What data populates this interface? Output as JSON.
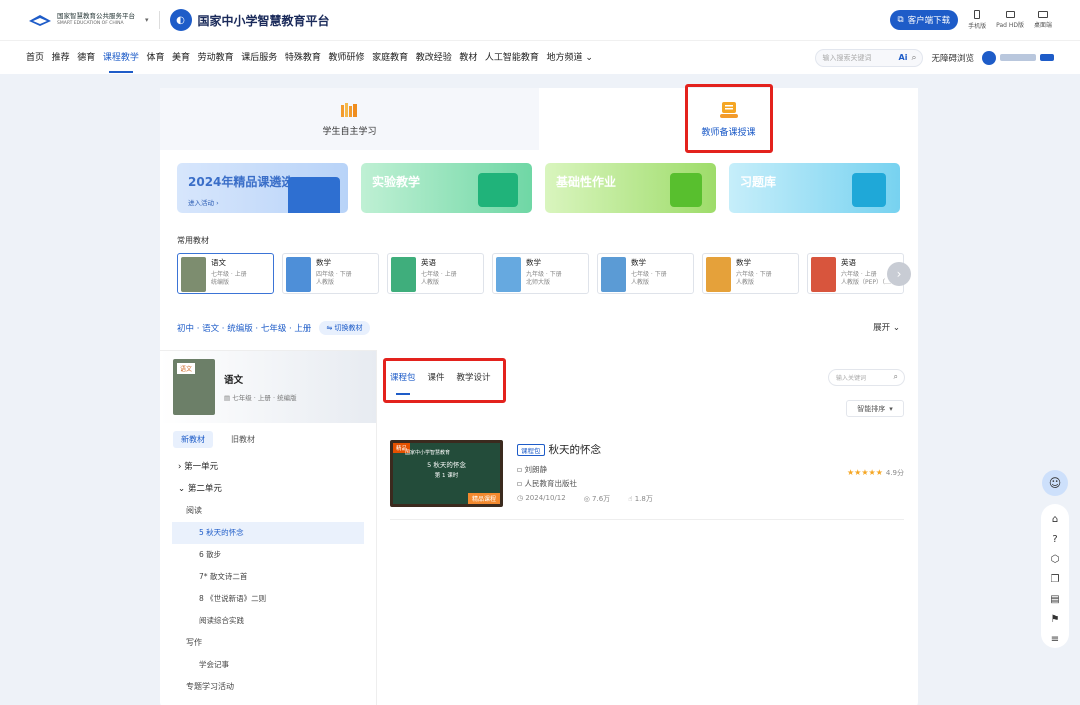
{
  "header": {
    "platform_cn": "国家智慧教育公共服务平台",
    "platform_en": "SMART EDUCATION OF CHINA",
    "site_name": "国家中小学智慧教育平台",
    "download_label": "客户端下载",
    "devices": [
      "手机版",
      "Pad HD版",
      "桌面端"
    ]
  },
  "nav": {
    "items": [
      "首页",
      "推荐",
      "德育",
      "课程教学",
      "体育",
      "美育",
      "劳动教育",
      "课后服务",
      "特殊教育",
      "教师研修",
      "家庭教育",
      "教改经验",
      "教材",
      "人工智能教育",
      "地方频道 ⌄"
    ],
    "active_index": 3,
    "search_placeholder": "输入搜索关键词",
    "ai_label": "Ai",
    "accessibility": "无障碍浏览"
  },
  "modes": [
    "学生自主学习",
    "教师备课授课"
  ],
  "banners": [
    {
      "title": "2024年精品课遴选",
      "sub": "进入活动 ›"
    },
    {
      "title": "实验教学",
      "sub": ""
    },
    {
      "title": "基础性作业",
      "sub": ""
    },
    {
      "title": "习题库",
      "sub": ""
    }
  ],
  "common_label": "常用教材",
  "books": [
    {
      "name": "语文",
      "grade": "七年级 · 上册",
      "ed": "统编版",
      "color": "#7d8d6f"
    },
    {
      "name": "数学",
      "grade": "四年级 · 下册",
      "ed": "人教版",
      "color": "#4e8fd8"
    },
    {
      "name": "英语",
      "grade": "七年级 · 上册",
      "ed": "人教版",
      "color": "#3fae7c"
    },
    {
      "name": "数学",
      "grade": "九年级 · 下册",
      "ed": "北师大版",
      "color": "#66a9e0"
    },
    {
      "name": "数学",
      "grade": "七年级 · 下册",
      "ed": "人教版",
      "color": "#5b9bd5"
    },
    {
      "name": "数学",
      "grade": "六年级 · 下册",
      "ed": "人教版",
      "color": "#e5a13a"
    },
    {
      "name": "英语",
      "grade": "六年级 · 上册",
      "ed": "人教版（PEP）（…",
      "color": "#d8553d"
    }
  ],
  "crumb": "初中 · 语文 · 统编版 · 七年级 · 上册",
  "switch_label": "⇋ 切换教材",
  "expand_label": "展开 ⌄",
  "current_book": {
    "name": "语文",
    "sub": "七年级 · 上册 · 统编版",
    "cover_tag": "语文"
  },
  "versions": [
    "新教材",
    "旧教材"
  ],
  "tree": [
    {
      "type": "unit",
      "label": "›  第一单元"
    },
    {
      "type": "unit",
      "label": "⌄  第二单元"
    },
    {
      "type": "cat",
      "label": "阅读"
    },
    {
      "type": "les",
      "label": "5 秋天的怀念",
      "sel": true
    },
    {
      "type": "les",
      "label": "6 散步"
    },
    {
      "type": "les",
      "label": "7* 散文诗二首"
    },
    {
      "type": "les",
      "label": "8 《世说新语》二则"
    },
    {
      "type": "les",
      "label": "阅读综合实践"
    },
    {
      "type": "cat",
      "label": "写作"
    },
    {
      "type": "les",
      "label": "学会记事"
    },
    {
      "type": "cat",
      "label": "专题学习活动"
    }
  ],
  "res_tabs": [
    "课程包",
    "课件",
    "教学设计"
  ],
  "keyword_placeholder": "输入关键词",
  "sort_label": "智能排序",
  "resource": {
    "tag": "课程包",
    "title": "秋天的怀念",
    "author": "刘朗静",
    "publisher": "人民教育出版社",
    "date": "2024/10/12",
    "views": "7.6万",
    "likes": "1.8万",
    "stars": "★★★★★",
    "score": "4.9分",
    "thumb_head": "国家中小学智慧教育",
    "thumb_title": "5 秋天的怀念",
    "thumb_sub": "第 1 课时",
    "thumb_ribbon": "精品",
    "thumb_badge": "精品课程"
  },
  "sidebar_icons": [
    "home-icon",
    "help-icon",
    "shield-icon",
    "copy-icon",
    "document-icon",
    "feedback-icon",
    "menu-icon"
  ]
}
